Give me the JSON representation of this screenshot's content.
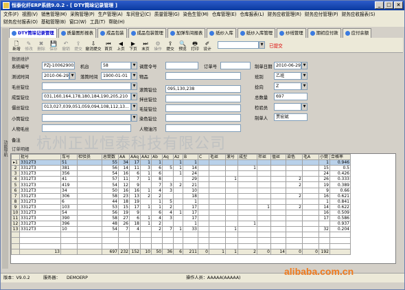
{
  "window": {
    "title": "恒泰化纤ERP系统9.0.2 - [ DTY筒垛记录管理 ]"
  },
  "menu": {
    "row1": [
      "文件(F)",
      "视图(V)",
      "销售管理(M)",
      "采购管理(P)",
      "生产管理(A)",
      "车间登记(C)",
      "质量管理(G)",
      "染色生管(M)",
      "仓库管理(E)",
      "仓库报表(L)",
      "财务应收管理(R)",
      "财务应付管理(P)",
      "财务应收报表(S)"
    ],
    "row2": [
      "财务应付报表(O)",
      "基础管理(B)",
      "窗口(W)",
      "工具(T)",
      "帮助(H)"
    ]
  },
  "left_strip": "功能导航",
  "tabs": [
    "DTY筒垛记录管理",
    "质量图形报表",
    "成品包装",
    "成品包装管理",
    "加弹车间报表",
    "纸纱入库",
    "纸纱入库管理",
    "纱线管理",
    "期初应付款",
    "应付余额"
  ],
  "toolbar": {
    "buttons": [
      "新增",
      "修改",
      "删除",
      "保存",
      "撤销",
      "提交",
      "撤消提交",
      "首页",
      "上页",
      "下页",
      "末页",
      "操作",
      "提交",
      "预览",
      "打印",
      "设计"
    ],
    "note": "已提交"
  },
  "form": {
    "section": "数据维护",
    "labels": {
      "sysno": "系统编号",
      "machine": "机台",
      "doc_no": "调度令号",
      "order_no": "订单号",
      "make_date": "制单日期",
      "test_time": "测试时间",
      "fall_time": "落筒时间",
      "product": "物品",
      "class": "班别",
      "hair": "毛丝锭位",
      "twist": "捻向",
      "pos_form": "成型锭位",
      "skip": "滚筒锭位",
      "yarn": "拌丝锭位",
      "total": "总数量",
      "color": "僵丝锭位",
      "inspector": "检验员",
      "mao": "毛锭锭位",
      "small": "小筒锭位",
      "dye": "染色锭位",
      "maker": "制单人",
      "person": "人物毛丝",
      "smudge": "人物油污",
      "remark": "备注"
    },
    "values": {
      "sysno": "PZJ-100629002",
      "machine": "58",
      "make_date": "2010-06-29",
      "test_date": "2010-06-29",
      "fall_time": "1900-01-01",
      "class": "乙班",
      "twist": "Z",
      "pos_form": "031,160,164,178,180,184,190,205,210",
      "skip": "095,130,238",
      "total": "697",
      "color": "013,027,039,051,059,094,108,112,13...",
      "maker": "贾宏斌"
    }
  },
  "grid_label": "订单明细",
  "grid": {
    "headers": [
      "批号",
      "车号",
      "检验员",
      "总筒数",
      "AA",
      "AAq",
      "AAz",
      "Ab",
      "Aq",
      "Az",
      "B",
      "C",
      "毛丝",
      "滚号",
      "成型",
      "拌丝",
      "僵丝",
      "染色",
      "毛A",
      "小筒",
      "合格率"
    ],
    "rows": [
      [
        "3312T3",
        "51",
        "",
        "55",
        "34",
        "17",
        "1",
        "1",
        "",
        "1",
        "1",
        "",
        "",
        "",
        "",
        "",
        "",
        "",
        "",
        "1",
        "0.946"
      ],
      [
        "3312T3",
        "381",
        "",
        "56",
        "14",
        "11",
        "3",
        "6",
        "5",
        "1",
        "14",
        "",
        "",
        "",
        "1",
        "",
        "",
        "",
        "",
        "15",
        "0.5"
      ],
      [
        "3312T3",
        "356",
        "",
        "54",
        "16",
        "6",
        "1",
        "6",
        "",
        "1",
        "24",
        "",
        "",
        "",
        "",
        "",
        "",
        "",
        "",
        "24",
        "0.426"
      ],
      [
        "3312T3",
        "41",
        "",
        "57",
        "11",
        "7",
        "1",
        "8",
        "",
        "",
        "29",
        "",
        "",
        "1",
        "",
        "",
        "",
        "2",
        "",
        "26",
        "0.333"
      ],
      [
        "3312T3",
        "419",
        "",
        "54",
        "12",
        "9",
        "",
        "7",
        "3",
        "2",
        "21",
        "",
        "",
        "",
        "",
        "",
        "",
        "2",
        "",
        "19",
        "0.389"
      ],
      [
        "3312T3",
        "34",
        "",
        "50",
        "16",
        "16",
        "1",
        "4",
        "3",
        "",
        "10",
        "",
        "",
        "",
        "",
        "",
        "",
        "",
        "",
        "9",
        "0.66"
      ],
      [
        "3312T3",
        "306",
        "",
        "58",
        "23",
        "13",
        "2",
        "2",
        "",
        "",
        "18",
        "",
        "",
        "",
        "",
        "",
        "",
        "2",
        "",
        "16",
        "0.621"
      ],
      [
        "3312T3",
        "6",
        "",
        "44",
        "18",
        "19",
        "",
        "1",
        "5",
        "",
        "1",
        "",
        "",
        "",
        "",
        "",
        "",
        "",
        "",
        "1",
        "0.841"
      ],
      [
        "3312T3",
        "103",
        "",
        "53",
        "15",
        "17",
        "1",
        "1",
        "2",
        "",
        "17",
        "",
        "",
        "",
        "",
        "1",
        "",
        "2",
        "",
        "14",
        "0.622"
      ],
      [
        "3312T3",
        "54",
        "",
        "56",
        "19",
        "9",
        "",
        "6",
        "4",
        "1",
        "17",
        "",
        "",
        "",
        "",
        "",
        "",
        "",
        "",
        "16",
        "0.509"
      ],
      [
        "3312T3",
        "390",
        "",
        "58",
        "27",
        "6",
        "1",
        "4",
        "3",
        "",
        "17",
        "",
        "",
        "",
        "",
        "",
        "",
        "",
        "",
        "17",
        "0.586"
      ],
      [
        "3312T3",
        "396",
        "",
        "48",
        "26",
        "18",
        "1",
        "2",
        "",
        "",
        "1",
        "",
        "",
        "",
        "1",
        "",
        "",
        "",
        "",
        "",
        "0.937"
      ],
      [
        "3312T3",
        "10",
        "",
        "54",
        "7",
        "4",
        "",
        "2",
        "7",
        "1",
        "33",
        "",
        "",
        "1",
        "",
        "",
        "",
        "",
        "",
        "32",
        "0.204"
      ]
    ],
    "totals": [
      "13",
      "",
      "",
      "697",
      "232",
      "152",
      "10",
      "50",
      "36",
      "6",
      "211",
      "0",
      "1",
      "1",
      "2",
      "0",
      "14",
      "0",
      "0",
      "192",
      ""
    ]
  },
  "status": {
    "version": "版本：V9.0.2",
    "server": "服务器：",
    "db": "DEMOERP",
    "operator": "操作人员：AAAAA(AAAAA)",
    "watermark": "alibaba.com.cn"
  },
  "watermark_bg": "杭州正业恒泰科技有限公司"
}
